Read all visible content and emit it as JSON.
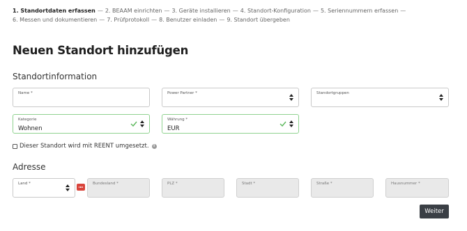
{
  "steps": {
    "items": [
      "1. Standortdaten erfassen",
      "2. BEAAM einrichten",
      "3. Geräte installieren",
      "4. Standort-Konfiguration",
      "5. Seriennummern erfassen",
      "6. Messen und dokumentieren",
      "7. Prüfprotokoll",
      "8. Benutzer einladen",
      "9. Standort übergeben"
    ],
    "separator": "—"
  },
  "page": {
    "title": "Neuen Standort hinzufügen"
  },
  "standortinfo": {
    "heading": "Standortinformation",
    "name": {
      "label": "Name *",
      "value": ""
    },
    "power_partner": {
      "label": "Power Partner *",
      "value": ""
    },
    "standortgruppen": {
      "label": "Standortgruppen",
      "value": ""
    },
    "kategorie": {
      "label": "Kategorie",
      "value": "Wohnen"
    },
    "waehrung": {
      "label": "Währung *",
      "value": "EUR"
    },
    "reent": {
      "label": "Dieser Standort wird mit REENT umgesetzt.",
      "checked": false
    },
    "valid_color": "#5cb85c"
  },
  "adresse": {
    "heading": "Adresse",
    "land": {
      "label": "Land *",
      "value": ""
    },
    "bundesland": {
      "label": "Bundesland *",
      "value": ""
    },
    "plz": {
      "label": "PLZ *",
      "value": ""
    },
    "stadt": {
      "label": "Stadt *",
      "value": ""
    },
    "strasse": {
      "label": "Straße *",
      "value": ""
    },
    "hausnummer": {
      "label": "Hausnummer *",
      "value": ""
    }
  },
  "footer": {
    "next_label": "Weiter"
  },
  "colors": {
    "button_bg": "#3a3f45",
    "error_badge": "#d9443b"
  }
}
